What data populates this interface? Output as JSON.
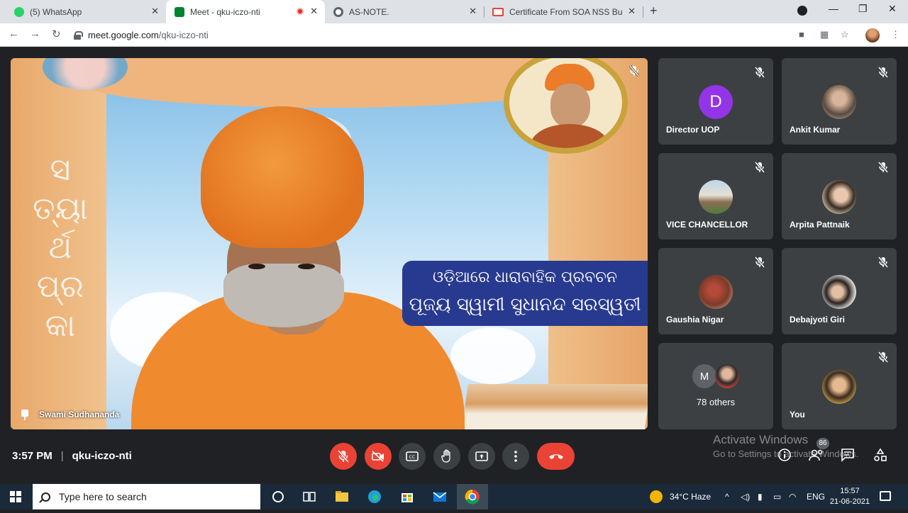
{
  "browser": {
    "tabs": [
      {
        "title": "(5) WhatsApp",
        "favicon": "whatsapp-icon",
        "color": "#25d366"
      },
      {
        "title": "Meet - qku-iczo-nti",
        "favicon": "google-meet-icon",
        "color": "#00832d",
        "active": true,
        "recording": true
      },
      {
        "title": "AS-NOTE.",
        "favicon": "globe-icon",
        "color": "#5f6368"
      },
      {
        "title": "Certificate From SOA NSS Burea",
        "favicon": "gmail-icon",
        "color": "#ea4335"
      }
    ],
    "url_host": "meet.google.com",
    "url_path": "/qku-iczo-nti"
  },
  "main_speaker": {
    "name": "Swami Sudhananda",
    "banner_line1": "ଓଡ଼ିଆରେ ଧାରାବାହିକ ପ୍ରବଚନ",
    "banner_line2": "ପୂଜ୍ୟ ସ୍ୱାମୀ ସୁଧାନନ୍ଦ ସରସ୍ୱତୀ",
    "side_text": [
      "ସ",
      "ତ୍ୟା",
      "ର୍ଥ",
      "ପ୍ର",
      "କା"
    ]
  },
  "participants": [
    {
      "name": "Director UOP",
      "avatar_letter": "D",
      "avatar_color": "#9334e6"
    },
    {
      "name": "Ankit Kumar"
    },
    {
      "name": "VICE CHANCELLOR"
    },
    {
      "name": "Arpita Pattnaik"
    },
    {
      "name": "Gaushia Nigar"
    },
    {
      "name": "Debajyoti Giri"
    },
    {
      "name": "78 others",
      "mini_letter": "M"
    },
    {
      "name": "You"
    }
  ],
  "controls": {
    "time": "3:57 PM",
    "separator": "|",
    "meeting_code": "qku-iczo-nti",
    "people_count": "86",
    "accent_red": "#ea4335"
  },
  "watermark": {
    "line1": "Activate Windows",
    "line2": "Go to Settings to activate Windows."
  },
  "taskbar": {
    "search_placeholder": "Type here to search",
    "weather": "34°C  Haze",
    "language": "ENG",
    "time": "15:57",
    "date": "21-06-2021"
  }
}
